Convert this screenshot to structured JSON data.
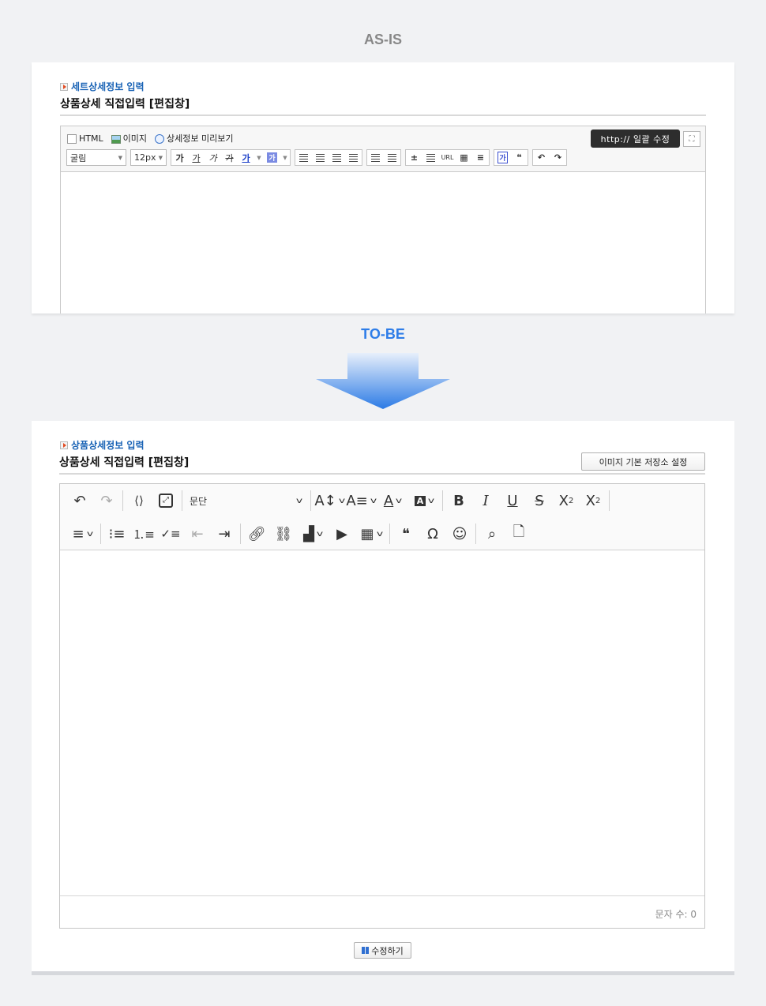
{
  "labels": {
    "asis": "AS-IS",
    "tobe": "TO-BE"
  },
  "asis": {
    "section_title": "세트상세정보 입력",
    "main_title": "상품상세 직접입력 [편집창]",
    "toolbar": {
      "html_label": "HTML",
      "image_label": "이미지",
      "preview_label": "상세정보 미리보기",
      "bulk_edit_label": "http:// 일괄 수정",
      "font_family": "굴림",
      "font_size": "12px",
      "url_label": "URL"
    }
  },
  "tobe": {
    "section_title": "상품상세정보 입력",
    "main_title": "상품상세 직접입력 [편집창]",
    "storage_button": "이미지 기본 저장소 설정",
    "toolbar": {
      "paragraph_label": "문단"
    },
    "char_count": "문자 수: 0",
    "save_button": "수정하기"
  }
}
